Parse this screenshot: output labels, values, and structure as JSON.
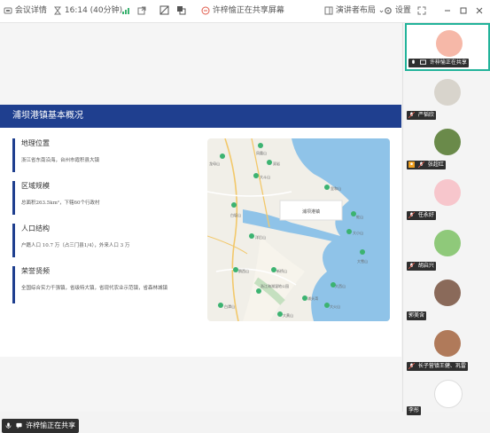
{
  "topbar": {
    "meeting_details": "会议详情",
    "time": "16:14 (40分钟)",
    "sharing_status": "许梓愉正在共享屏幕",
    "layout": "演讲者布局",
    "settings": "设置"
  },
  "slide": {
    "title": "浦坝港镇基本概况",
    "sections": [
      {
        "heading": "地理位置",
        "text": "浙江省东南沿海，台州市霞积县大镇"
      },
      {
        "heading": "区域规模",
        "text": "总面积263.5km²，下辖60个行政村"
      },
      {
        "heading": "人口结构",
        "text": "户籍人口 10.7 万（占三门县1/4），外来人口 3 万"
      },
      {
        "heading": "荣誉贤频",
        "text": "全国综合实力千强镇，省级特大镇，省现代农业示范镇，省森林城镇"
      }
    ],
    "map_labels": {
      "center": "浦坝港镇",
      "places": [
        "龙母山",
        "凤凰山",
        "双岩",
        "大斗山",
        "里和山",
        "白坂山",
        "洋后山",
        "蛇山",
        "大小山",
        "大雪山",
        "大西山",
        "新桥山",
        "鹅西山",
        "白潭山",
        "大黄山",
        "大火山",
        "浦头湾",
        "新桥山",
        "浙江海湖湿地公园",
        "上洋岩",
        "大小山湾",
        "洋岩山"
      ]
    }
  },
  "bottom_share_label": "许梓愉正在共享",
  "participants": [
    {
      "name": "许梓愉正在共享",
      "avatar_color": "#f6b8a8"
    },
    {
      "name": "严韬欣",
      "avatar_color": "#d8d4cc"
    },
    {
      "name": "张超红",
      "avatar_color": "#6a8a4a"
    },
    {
      "name": "任永好",
      "avatar_color": "#f7c6cc"
    },
    {
      "name": "胡启兴",
      "avatar_color": "#8fc97a"
    },
    {
      "name": "郭美含",
      "avatar_color": "#8a6a5a"
    },
    {
      "name": "长子营镇王健、巩雷",
      "avatar_color": "#b07a5a"
    },
    {
      "name": "李彤",
      "avatar_color": "#ffffff"
    }
  ],
  "colors": {
    "accent": "#22b39a",
    "title_bar": "#1f3f8f",
    "water": "#8fc3e8"
  }
}
